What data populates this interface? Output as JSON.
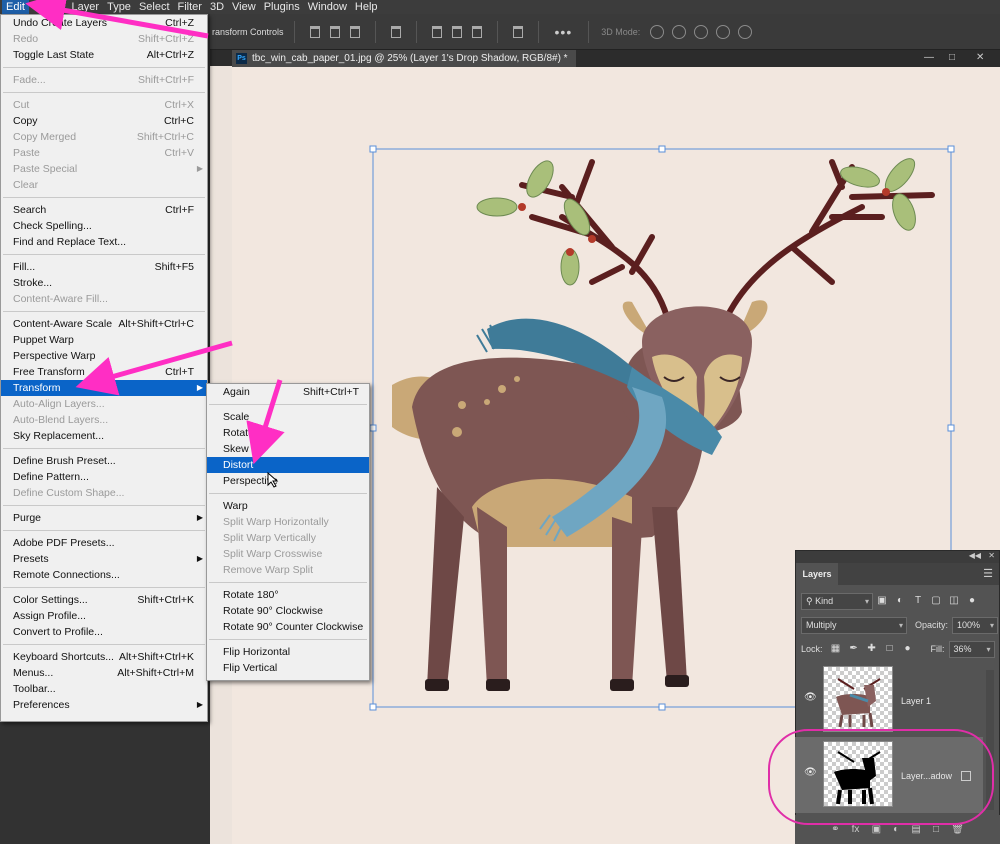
{
  "menubar": {
    "items": [
      "Edit",
      "Image",
      "Layer",
      "Type",
      "Select",
      "Filter",
      "3D",
      "View",
      "Plugins",
      "Window",
      "Help"
    ]
  },
  "optionsbar": {
    "transform_controls": "ransform Controls",
    "mode_label": "3D Mode:"
  },
  "document": {
    "tab_title": "tbc_win_cab_paper_01.jpg @ 25% (Layer 1's Drop Shadow, RGB/8#) *",
    "ps_icon_label": "Ps",
    "window_controls": [
      "—",
      "□",
      "✕"
    ]
  },
  "edit_menu": {
    "items": [
      {
        "label": "Undo Create Layers",
        "shortcut": "Ctrl+Z",
        "enabled": true
      },
      {
        "label": "Redo",
        "shortcut": "Shift+Ctrl+Z",
        "enabled": false
      },
      {
        "label": "Toggle Last State",
        "shortcut": "Alt+Ctrl+Z",
        "enabled": true
      },
      {
        "sep": true
      },
      {
        "label": "Fade...",
        "shortcut": "Shift+Ctrl+F",
        "enabled": false
      },
      {
        "sep": true
      },
      {
        "label": "Cut",
        "shortcut": "Ctrl+X",
        "enabled": false
      },
      {
        "label": "Copy",
        "shortcut": "Ctrl+C",
        "enabled": true
      },
      {
        "label": "Copy Merged",
        "shortcut": "Shift+Ctrl+C",
        "enabled": false
      },
      {
        "label": "Paste",
        "shortcut": "Ctrl+V",
        "enabled": false
      },
      {
        "label": "Paste Special",
        "shortcut": "",
        "enabled": false,
        "submenu": true
      },
      {
        "label": "Clear",
        "shortcut": "",
        "enabled": false
      },
      {
        "sep": true
      },
      {
        "label": "Search",
        "shortcut": "Ctrl+F",
        "enabled": true
      },
      {
        "label": "Check Spelling...",
        "shortcut": "",
        "enabled": true
      },
      {
        "label": "Find and Replace Text...",
        "shortcut": "",
        "enabled": true
      },
      {
        "sep": true
      },
      {
        "label": "Fill...",
        "shortcut": "Shift+F5",
        "enabled": true
      },
      {
        "label": "Stroke...",
        "shortcut": "",
        "enabled": true
      },
      {
        "label": "Content-Aware Fill...",
        "shortcut": "",
        "enabled": false
      },
      {
        "sep": true
      },
      {
        "label": "Content-Aware Scale",
        "shortcut": "Alt+Shift+Ctrl+C",
        "enabled": true
      },
      {
        "label": "Puppet Warp",
        "shortcut": "",
        "enabled": true
      },
      {
        "label": "Perspective Warp",
        "shortcut": "",
        "enabled": true
      },
      {
        "label": "Free Transform",
        "shortcut": "Ctrl+T",
        "enabled": true
      },
      {
        "label": "Transform",
        "shortcut": "",
        "enabled": true,
        "submenu": true,
        "highlighted": true
      },
      {
        "label": "Auto-Align Layers...",
        "shortcut": "",
        "enabled": false
      },
      {
        "label": "Auto-Blend Layers...",
        "shortcut": "",
        "enabled": false
      },
      {
        "label": "Sky Replacement...",
        "shortcut": "",
        "enabled": true
      },
      {
        "sep": true
      },
      {
        "label": "Define Brush Preset...",
        "shortcut": "",
        "enabled": true
      },
      {
        "label": "Define Pattern...",
        "shortcut": "",
        "enabled": true
      },
      {
        "label": "Define Custom Shape...",
        "shortcut": "",
        "enabled": false
      },
      {
        "sep": true
      },
      {
        "label": "Purge",
        "shortcut": "",
        "enabled": true,
        "submenu": true
      },
      {
        "sep": true
      },
      {
        "label": "Adobe PDF Presets...",
        "shortcut": "",
        "enabled": true
      },
      {
        "label": "Presets",
        "shortcut": "",
        "enabled": true,
        "submenu": true
      },
      {
        "label": "Remote Connections...",
        "shortcut": "",
        "enabled": true
      },
      {
        "sep": true
      },
      {
        "label": "Color Settings...",
        "shortcut": "Shift+Ctrl+K",
        "enabled": true
      },
      {
        "label": "Assign Profile...",
        "shortcut": "",
        "enabled": true
      },
      {
        "label": "Convert to Profile...",
        "shortcut": "",
        "enabled": true
      },
      {
        "sep": true
      },
      {
        "label": "Keyboard Shortcuts...",
        "shortcut": "Alt+Shift+Ctrl+K",
        "enabled": true
      },
      {
        "label": "Menus...",
        "shortcut": "Alt+Shift+Ctrl+M",
        "enabled": true
      },
      {
        "label": "Toolbar...",
        "shortcut": "",
        "enabled": true
      },
      {
        "label": "Preferences",
        "shortcut": "",
        "enabled": true,
        "submenu": true
      }
    ]
  },
  "transform_submenu": {
    "items": [
      {
        "label": "Again",
        "shortcut": "Shift+Ctrl+T",
        "enabled": true
      },
      {
        "sep": true
      },
      {
        "label": "Scale",
        "shortcut": "",
        "enabled": true
      },
      {
        "label": "Rotate",
        "shortcut": "",
        "enabled": true
      },
      {
        "label": "Skew",
        "shortcut": "",
        "enabled": true
      },
      {
        "label": "Distort",
        "shortcut": "",
        "enabled": true,
        "highlighted": true
      },
      {
        "label": "Perspective",
        "shortcut": "",
        "enabled": true
      },
      {
        "sep": true
      },
      {
        "label": "Warp",
        "shortcut": "",
        "enabled": true
      },
      {
        "label": "Split Warp Horizontally",
        "shortcut": "",
        "enabled": false
      },
      {
        "label": "Split Warp Vertically",
        "shortcut": "",
        "enabled": false
      },
      {
        "label": "Split Warp Crosswise",
        "shortcut": "",
        "enabled": false
      },
      {
        "label": "Remove Warp Split",
        "shortcut": "",
        "enabled": false
      },
      {
        "sep": true
      },
      {
        "label": "Rotate 180°",
        "shortcut": "",
        "enabled": true
      },
      {
        "label": "Rotate 90° Clockwise",
        "shortcut": "",
        "enabled": true
      },
      {
        "label": "Rotate 90° Counter Clockwise",
        "shortcut": "",
        "enabled": true
      },
      {
        "sep": true
      },
      {
        "label": "Flip Horizontal",
        "shortcut": "",
        "enabled": true
      },
      {
        "label": "Flip Vertical",
        "shortcut": "",
        "enabled": true
      }
    ]
  },
  "layers_panel": {
    "tab_label": "Layers",
    "filter_kind": "Kind",
    "blend_mode": "Multiply",
    "opacity_label": "Opacity:",
    "opacity_value": "100%",
    "lock_label": "Lock:",
    "fill_label": "Fill:",
    "fill_value": "36%",
    "layers": [
      {
        "name": "Layer 1",
        "visible": true,
        "selected": false
      },
      {
        "name": "Layer...adow",
        "visible": true,
        "selected": true
      }
    ]
  },
  "colors": {
    "highlight": "#0a64c8",
    "annotation": "#ff2ec4",
    "canvas_bg": "#f2e7df",
    "deer_body": "#7e5653",
    "scarf": "#4a8aa8"
  }
}
